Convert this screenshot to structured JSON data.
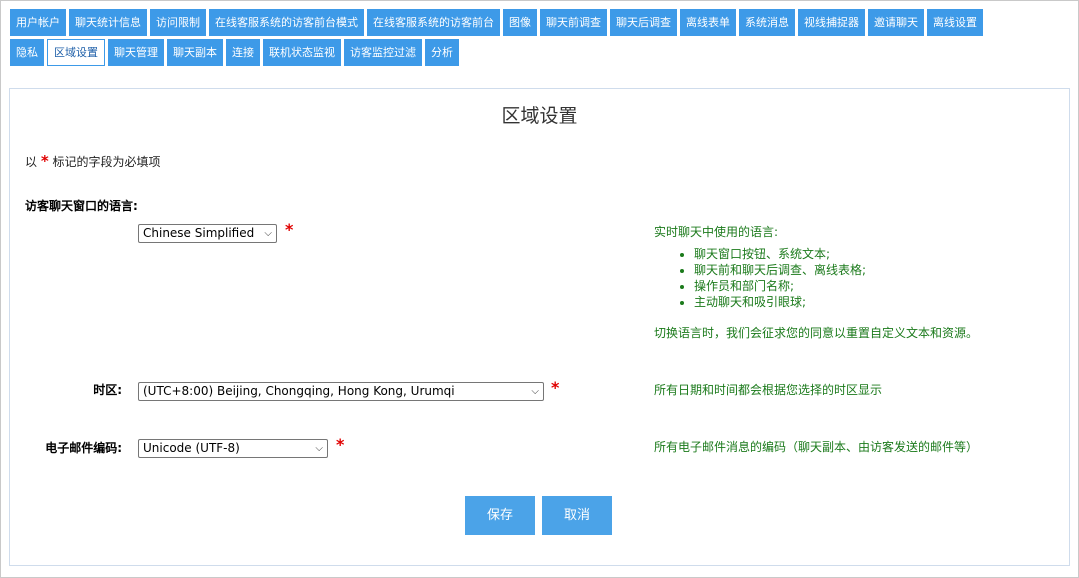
{
  "tabs_row1": [
    "用户帐户",
    "聊天统计信息",
    "访问限制",
    "在线客服系统的访客前台模式",
    "在线客服系统的访客前台",
    "图像",
    "聊天前调查",
    "聊天后调查",
    "离线表单",
    "系统消息",
    "视线捕捉器",
    "邀请聊天",
    "离线设置"
  ],
  "tabs_row2": [
    "隐私",
    "区域设置",
    "聊天管理",
    "聊天副本",
    "连接",
    "联机状态监视",
    "访客监控过滤",
    "分析"
  ],
  "page": {
    "title": "区域设置",
    "required_prefix": "以",
    "required_star": "*",
    "required_suffix": "标记的字段为必填项"
  },
  "language": {
    "section_label": "访客聊天窗口的语言:",
    "selected": "Chinese Simplified",
    "help_intro": "实时聊天中使用的语言:",
    "help_items": [
      "聊天窗口按钮、系统文本;",
      "聊天前和聊天后调查、离线表格;",
      "操作员和部门名称;",
      "主动聊天和吸引眼球;"
    ],
    "help_note": "切换语言时，我们会征求您的同意以重置自定义文本和资源。"
  },
  "timezone": {
    "label": "时区:",
    "selected": "(UTC+8:00) Beijing, Chongqing, Hong Kong, Urumqi",
    "help": "所有日期和时间都会根据您选择的时区显示"
  },
  "email_encoding": {
    "label": "电子邮件编码:",
    "selected": "Unicode (UTF-8)",
    "help": "所有电子邮件消息的编码（聊天副本、由访客发送的邮件等）"
  },
  "buttons": {
    "save": "保存",
    "cancel": "取消"
  },
  "icons": {
    "select_arrow": "chevron-down-icon"
  },
  "colors": {
    "tab_bg": "#3d9ae8",
    "button_bg": "#4ba3e8",
    "required": "#e00000",
    "help_text": "#1b7a1b"
  }
}
